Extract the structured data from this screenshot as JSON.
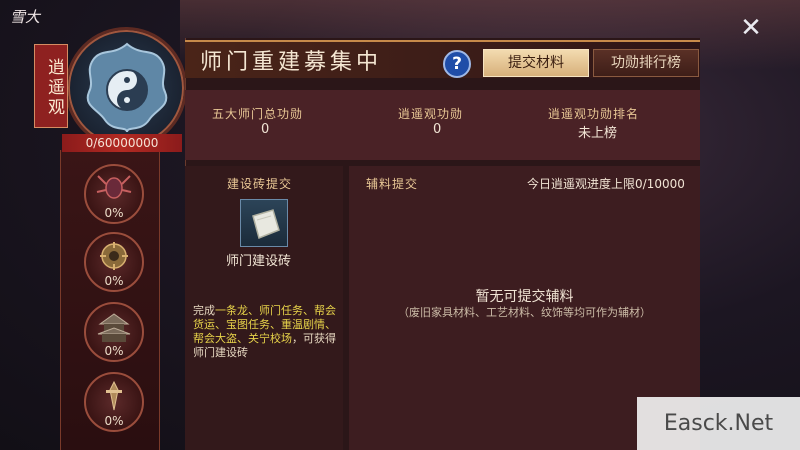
{
  "game": {
    "logo_text": "雪大"
  },
  "close": {
    "icon": "close-icon"
  },
  "sect": {
    "tag": "逍遥观",
    "progress": "0/60000000",
    "emblem": "yin-yang-emblem-icon",
    "medals": [
      {
        "icon": "spider-demon-icon",
        "percent": "0%"
      },
      {
        "icon": "compass-artifact-icon",
        "percent": "0%"
      },
      {
        "icon": "pagoda-building-icon",
        "percent": "0%"
      },
      {
        "icon": "sword-statue-icon",
        "percent": "0%"
      }
    ]
  },
  "header": {
    "title": "师门重建募集中",
    "help": "?",
    "tabs": [
      {
        "label": "提交材料",
        "active": true
      },
      {
        "label": "功勋排行榜",
        "active": false
      }
    ]
  },
  "stats": [
    {
      "label": "五大师门总功勋",
      "value": "0"
    },
    {
      "label": "逍遥观功勋",
      "value": "0"
    },
    {
      "label": "逍遥观功勋排名",
      "value": "未上榜"
    }
  ],
  "brick": {
    "title": "建设砖提交",
    "item_name": "师门建设砖",
    "item_icon": "brick-icon",
    "desc_prefix": "完成",
    "desc_parts": [
      {
        "text": "一条龙、师门任务、帮会货运、宝图任务、重温剧情、帮会大盗、关宁校场",
        "highlight": true
      },
      {
        "text": "，可获得师门建设砖",
        "highlight": false
      }
    ]
  },
  "materials": {
    "title": "辅料提交",
    "limit": "今日逍遥观进度上限0/10000",
    "empty": "暂无可提交辅料",
    "empty_sub": "（废旧家具材料、工艺材料、纹饰等均可作为辅材）"
  },
  "watermark": {
    "text": "Easck.Net"
  },
  "colors": {
    "accent_red": "#8e2120",
    "tab_active": "#d7b07a",
    "help_blue": "#1f4da8",
    "highlight": "#e7d34a"
  }
}
